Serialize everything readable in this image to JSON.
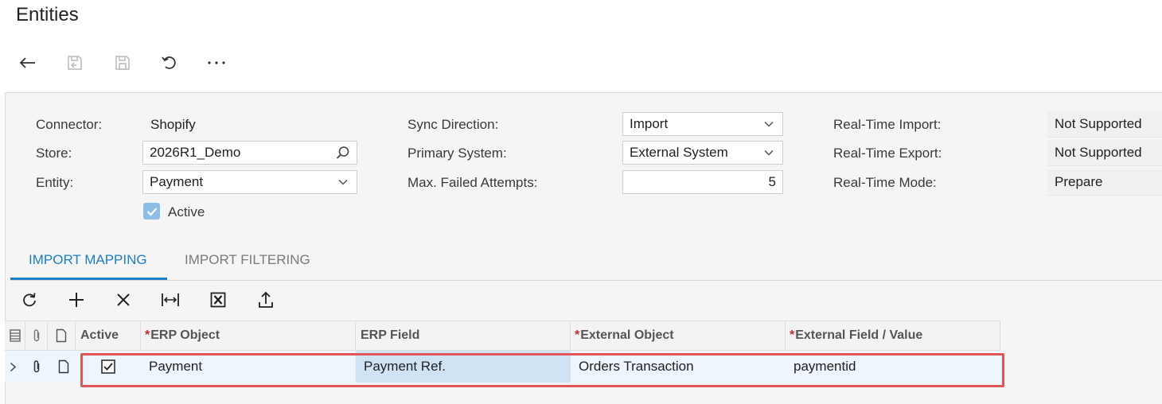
{
  "page": {
    "title": "Entities"
  },
  "toolbar": {
    "icons": [
      "back-arrow-icon",
      "save-and-close-icon",
      "save-icon",
      "undo-icon",
      "more-icon"
    ]
  },
  "form": {
    "connector": {
      "label": "Connector:",
      "value": "Shopify"
    },
    "store": {
      "label": "Store:",
      "value": "2026R1_Demo"
    },
    "entity": {
      "label": "Entity:",
      "value": "Payment"
    },
    "active": {
      "label": "Active",
      "checked": true
    },
    "sync_direction": {
      "label": "Sync Direction:",
      "value": "Import"
    },
    "primary_system": {
      "label": "Primary System:",
      "value": "External System"
    },
    "max_failed": {
      "label": "Max. Failed Attempts:",
      "value": "5"
    },
    "rt_import": {
      "label": "Real-Time Import:",
      "value": "Not Supported"
    },
    "rt_export": {
      "label": "Real-Time Export:",
      "value": "Not Supported"
    },
    "rt_mode": {
      "label": "Real-Time Mode:",
      "value": "Prepare"
    }
  },
  "tabs": [
    {
      "label": "IMPORT MAPPING",
      "active": true
    },
    {
      "label": "IMPORT FILTERING",
      "active": false
    }
  ],
  "grid": {
    "toolbar_icons": [
      "refresh-icon",
      "add-row-icon",
      "delete-row-icon",
      "fit-columns-icon",
      "export-excel-icon",
      "upload-icon"
    ],
    "columns": {
      "active": "Active",
      "erp_object": "ERP Object",
      "erp_field": "ERP Field",
      "external_object": "External Object",
      "external_field": "External Field / Value"
    },
    "required_marker": "*",
    "rows": [
      {
        "active": true,
        "erp_object": "Payment",
        "erp_field": "Payment Ref.",
        "external_object": "Orders Transaction",
        "external_field": "paymentid"
      }
    ]
  },
  "colors": {
    "accent": "#1d7fc4",
    "required": "#d0262b",
    "highlight_border": "#e25556",
    "selected_cell": "#cfe3f5"
  }
}
